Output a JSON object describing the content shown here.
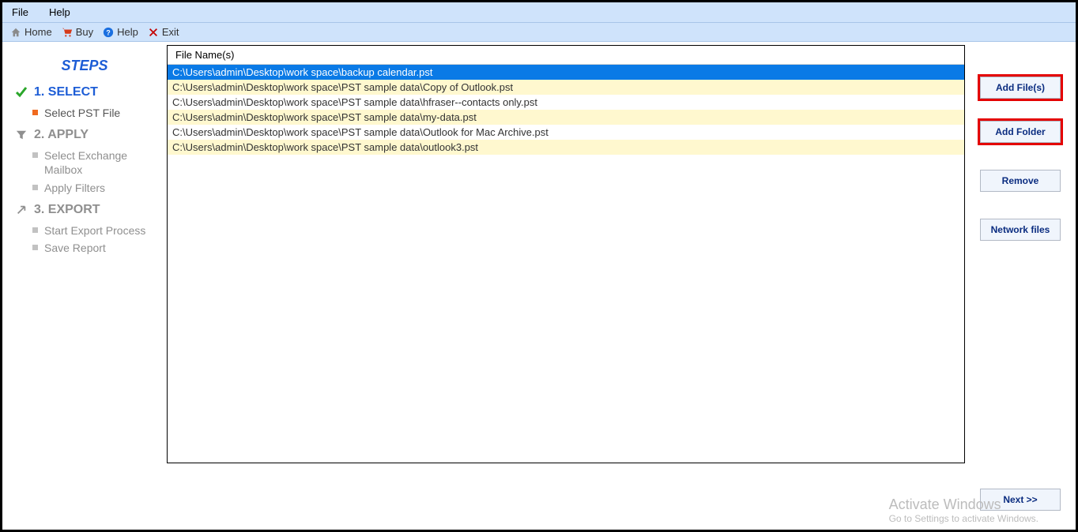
{
  "menubar": {
    "file": "File",
    "help": "Help"
  },
  "toolbar": {
    "home": "Home",
    "buy": "Buy",
    "help": "Help",
    "exit": "Exit"
  },
  "sidebar": {
    "steps_title": "STEPS",
    "step1": "1. SELECT",
    "step1_sub1": "Select PST File",
    "step2": "2. APPLY",
    "step2_sub1": "Select Exchange Mailbox",
    "step2_sub2": "Apply Filters",
    "step3": "3. EXPORT",
    "step3_sub1": "Start Export Process",
    "step3_sub2": "Save Report"
  },
  "grid": {
    "header": "File Name(s)",
    "rows": [
      "C:\\Users\\admin\\Desktop\\work space\\backup calendar.pst",
      "C:\\Users\\admin\\Desktop\\work space\\PST sample data\\Copy of Outlook.pst",
      "C:\\Users\\admin\\Desktop\\work space\\PST sample data\\hfraser--contacts only.pst",
      "C:\\Users\\admin\\Desktop\\work space\\PST sample data\\my-data.pst",
      "C:\\Users\\admin\\Desktop\\work space\\PST sample data\\Outlook for Mac Archive.pst",
      "C:\\Users\\admin\\Desktop\\work space\\PST sample data\\outlook3.pst"
    ]
  },
  "buttons": {
    "add_files": "Add File(s)",
    "add_folder": "Add Folder",
    "remove": "Remove",
    "network_files": "Network files",
    "next": "Next >>"
  },
  "watermark": {
    "line1": "Activate Windows",
    "line2": "Go to Settings to activate Windows."
  }
}
